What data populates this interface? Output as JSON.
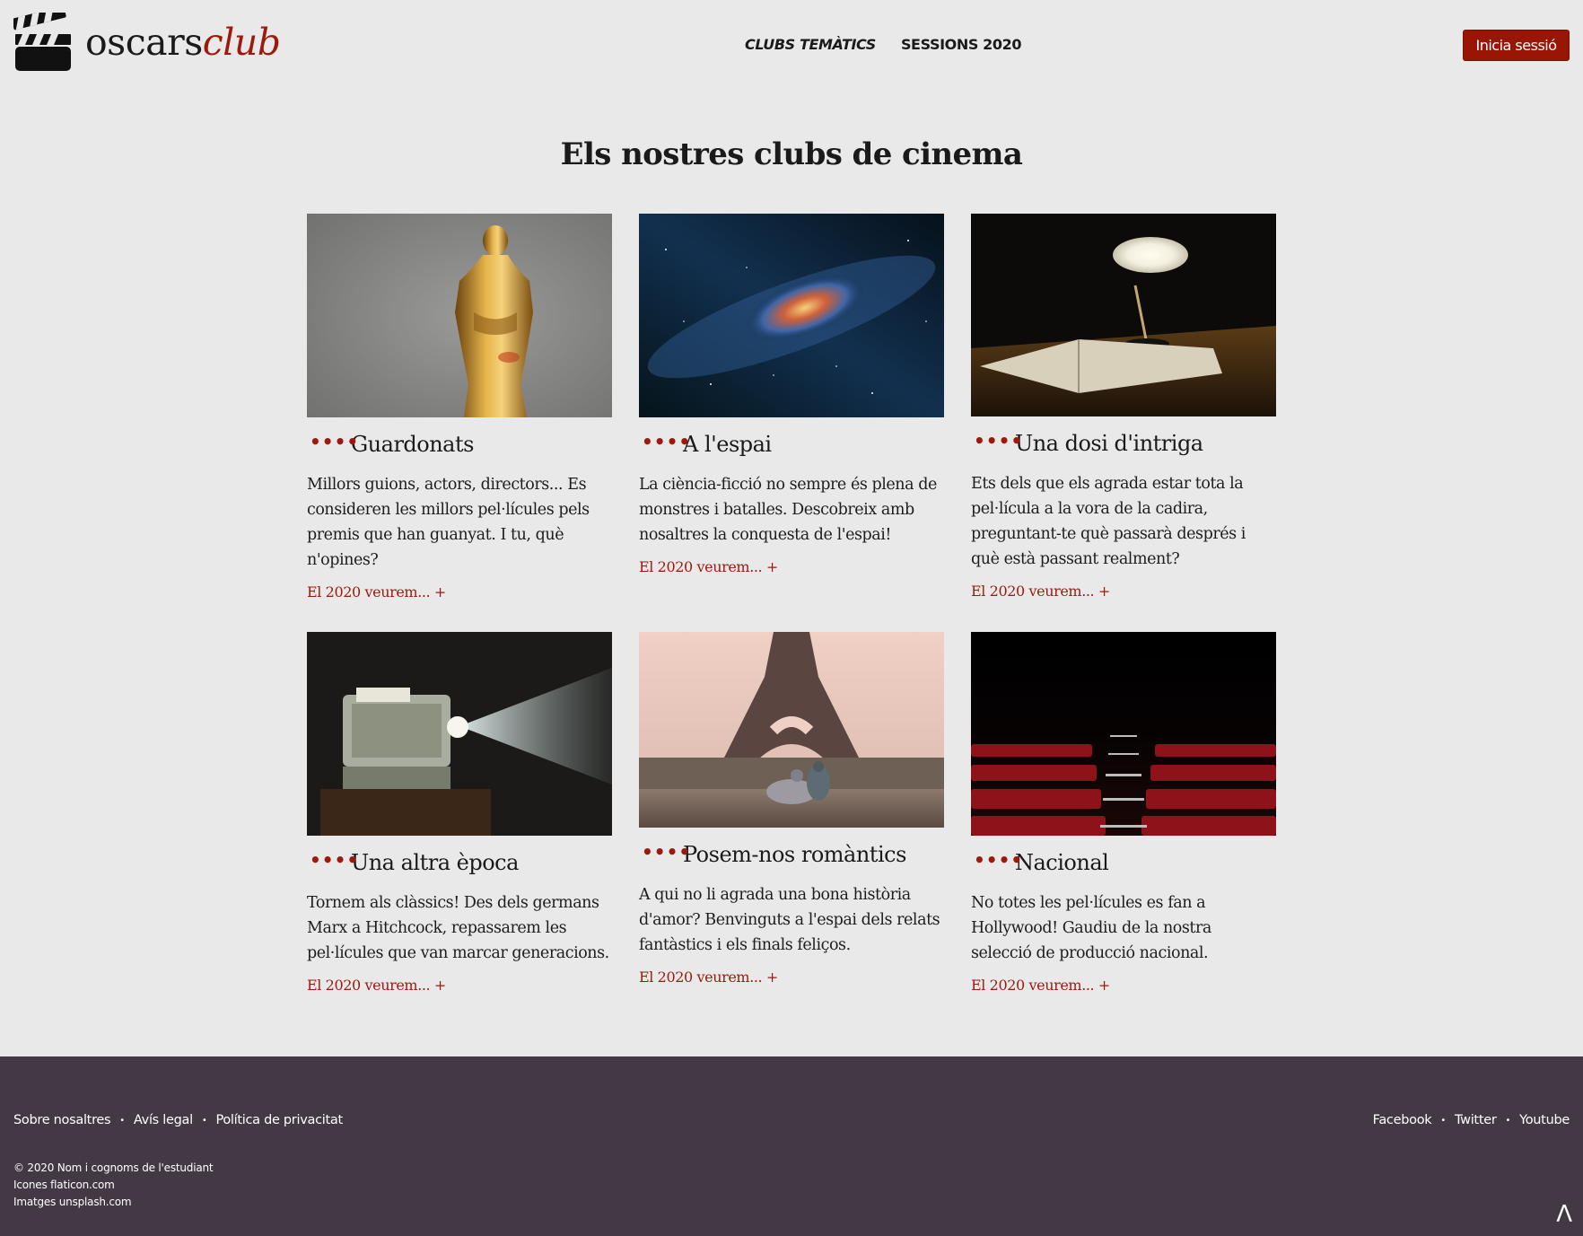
{
  "header": {
    "logo": {
      "word": "oscars",
      "accent": "club",
      "icon": "clapperboard-icon"
    },
    "nav": [
      {
        "label": "CLUBS TEMÀTICS",
        "active": true
      },
      {
        "label": "SESSIONS 2020",
        "active": false
      }
    ],
    "login_label": "Inicia sessió"
  },
  "main": {
    "title": "Els nostres clubs de cinema",
    "cards": [
      {
        "image": "oscar-statuette-photo",
        "dots": "••••",
        "title": "Guardonats",
        "description": "Millors guions, actors, directors... Es consideren les millors pel·lícules pels premis que han guanyat. I tu, què n'opines?",
        "link": "El 2020 veurem... +"
      },
      {
        "image": "milky-way-photo",
        "dots": "••••",
        "title": "A l'espai",
        "description": "La ciència-ficció no sempre és plena de monstres i batalles. Descobreix amb nosaltres la conquesta de l'espai!",
        "link": "El 2020 veurem... +"
      },
      {
        "image": "desk-lamp-book-photo",
        "dots": "••••",
        "title": "Una dosi d'intriga",
        "description": "Ets dels que els agrada estar tota la pel·lícula a la vora de la cadira, preguntant-te què passarà després i què està passant realment?",
        "link": "El 2020 veurem... +"
      },
      {
        "image": "film-projector-photo",
        "dots": "••••",
        "title": "Una altra època",
        "description": "Tornem als clàssics! Des dels germans Marx a Hitchcock, repassarem les pel·lícules que van marcar generacions.",
        "link": "El 2020 veurem... +"
      },
      {
        "image": "eiffel-tower-pigeons-photo",
        "dots": "••••",
        "title": "Posem-nos romàntics",
        "description": "A qui no li agrada una bona història d'amor? Benvinguts a l'espai dels relats fantàstics i els finals feliços.",
        "link": "El 2020 veurem... +"
      },
      {
        "image": "cinema-seats-photo",
        "dots": "••••",
        "title": "Nacional",
        "description": "No totes les pel·lícules es fan a Hollywood! Gaudiu de la nostra selecció de producció nacional.",
        "link": "El 2020 veurem... +"
      }
    ]
  },
  "footer": {
    "links": [
      "Sobre nosaltres",
      "Avís legal",
      "Política de privacitat"
    ],
    "social": [
      "Facebook",
      "Twitter",
      "Youtube"
    ],
    "separator": "•",
    "credits": [
      "© 2020 Nom i cognoms de l'estudiant",
      "Icones flaticon.com",
      "Imatges unsplash.com"
    ],
    "to_top": "Λ"
  },
  "colors": {
    "accent": "#9c1a0c",
    "background": "#e9e9e9",
    "footer_bg": "#433944"
  }
}
